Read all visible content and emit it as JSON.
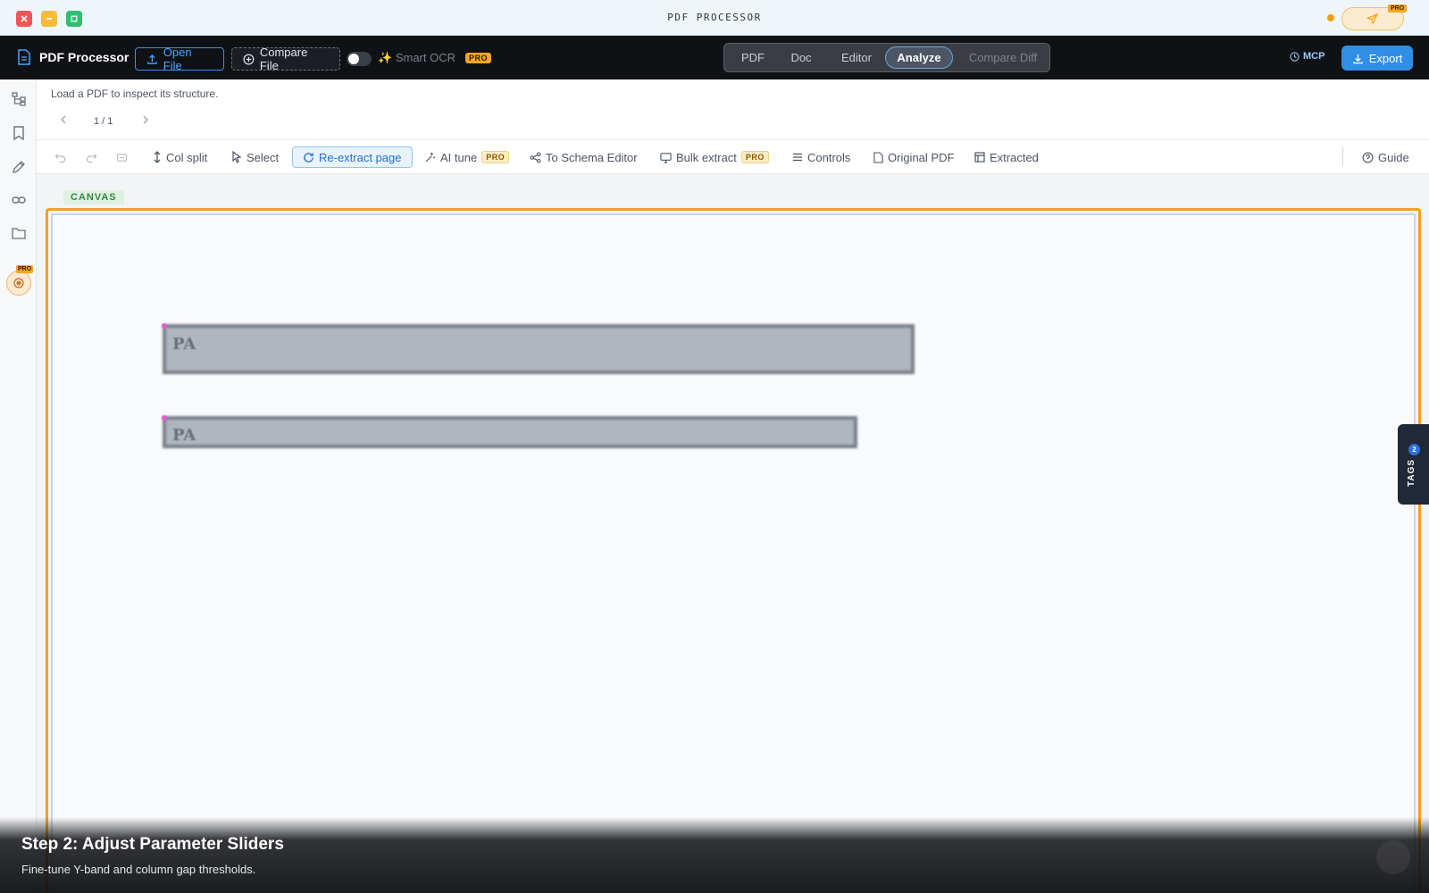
{
  "window": {
    "title": "PDF PROCESSOR",
    "send_pro": "PRO"
  },
  "header": {
    "brand": "PDF Processor",
    "open_file": "Open File",
    "compare_file": "Compare File",
    "smart_ocr": "Smart OCR",
    "smart_ocr_badge": "PRO",
    "smart_ocr_enabled": false,
    "tabs": [
      {
        "label": "PDF",
        "active": false
      },
      {
        "label": "Doc",
        "active": false
      },
      {
        "label": "Editor",
        "active": false
      },
      {
        "label": "Analyze",
        "active": true
      },
      {
        "label": "Compare Diff",
        "active": false
      }
    ],
    "mcp": "MCP",
    "export": "Export"
  },
  "sidebar": {
    "items": [
      {
        "icon": "structure-tree-icon"
      },
      {
        "icon": "bookmark-icon"
      },
      {
        "icon": "pen-edit-icon"
      },
      {
        "icon": "link-icon"
      },
      {
        "icon": "folder-icon"
      },
      {
        "icon": "ai-brain-icon",
        "badge": "PRO"
      }
    ]
  },
  "info": {
    "message": "Load a PDF to inspect its structure.",
    "page_indicator": "1 / 1"
  },
  "toolbar": {
    "col_split": "Col split",
    "select": "Select",
    "reextract": "Re-extract page",
    "ai_tune": "AI tune",
    "ai_tune_badge": "PRO",
    "to_schema": "To Schema Editor",
    "bulk_extract": "Bulk extract",
    "bulk_extract_badge": "PRO",
    "controls": "Controls",
    "original_pdf": "Original PDF",
    "extracted": "Extracted",
    "guide": "Guide"
  },
  "canvas": {
    "label": "CANVAS",
    "blocks": [
      {
        "text": "PA"
      },
      {
        "text": "PA"
      }
    ]
  },
  "tags_panel": {
    "label": "TAGS",
    "count": "2"
  },
  "tour": {
    "title": "Step 2: Adjust Parameter Sliders",
    "description": "Fine-tune Y-band and column gap thresholds."
  },
  "colors": {
    "accent": "#2f8fe5",
    "highlight_frame": "#f4a11e",
    "pro_badge": "#f5a623",
    "header_bg": "#0f1115"
  }
}
